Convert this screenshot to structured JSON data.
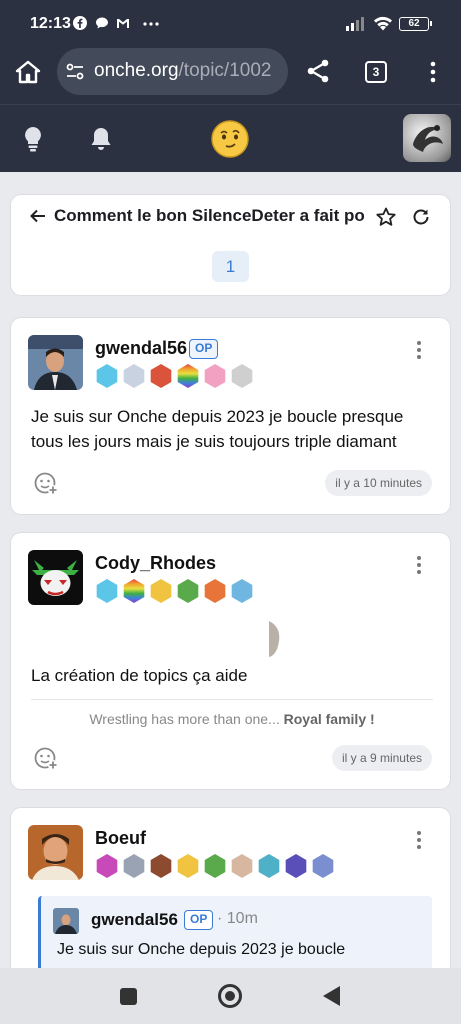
{
  "status": {
    "time": "12:13",
    "battery": "62"
  },
  "browser": {
    "url_host": "onche.org",
    "url_path": "/topic/1002",
    "tab_count": "3"
  },
  "topic": {
    "title": "Comment le bon SilenceDeter a fait po",
    "page": "1"
  },
  "posts": [
    {
      "username": "gwendal56",
      "op": "OP",
      "text": "Je suis sur Onche depuis 2023 je boucle presque tous les jours mais je suis toujours triple diamant",
      "time": "il y a 10 minutes",
      "badge_colors": [
        "#5cc6e8",
        "#c9d2e0",
        "#d9543a",
        "#e4c12b",
        "#f3a1c3",
        "#cfcfcf"
      ]
    },
    {
      "username": "Cody_Rhodes",
      "text": "La création de topics ça aide",
      "signature_prefix": "Wrestling has more than one...",
      "signature_bold": "Royal family !",
      "time": "il y a 9 minutes",
      "badge_colors": [
        "#5cc6e8",
        "#e4c12b",
        "#f0c340",
        "#5aa94a",
        "#e8743a",
        "#6fb6e0"
      ]
    },
    {
      "username": "Boeuf",
      "badge_colors": [
        "#c84ab8",
        "#9aa3b4",
        "#8c4a2f",
        "#f0c340",
        "#5aa94a",
        "#d8b7a1",
        "#4fb1c8",
        "#5a4fb8",
        "#7b8fd0"
      ],
      "quote": {
        "username": "gwendal56",
        "op": "OP",
        "time": "· 10m",
        "text": "Je suis sur Onche depuis 2023 je boucle"
      }
    }
  ],
  "colors": {
    "header": "#2b3141",
    "accent": "#3a7bd5",
    "background": "#e9eaee"
  }
}
